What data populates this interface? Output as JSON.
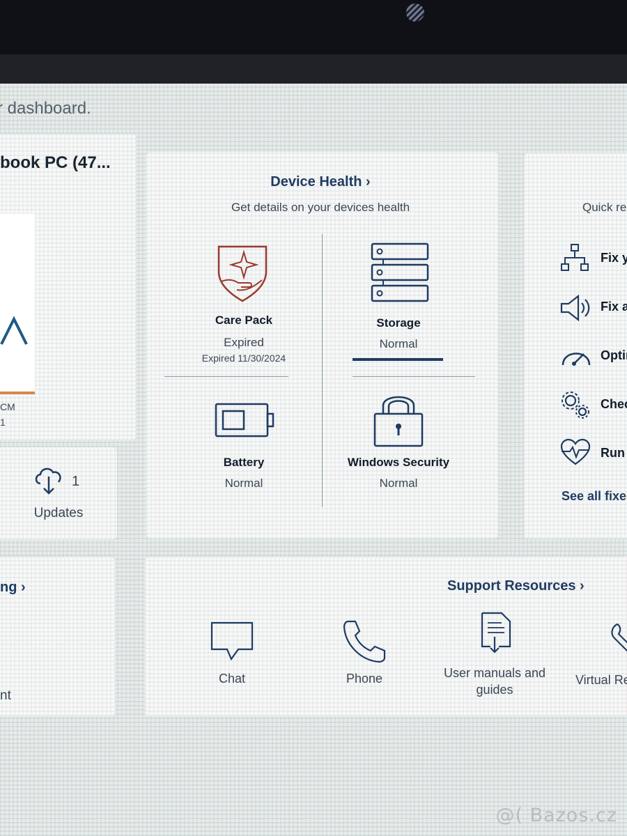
{
  "header": {
    "dashboard_text": "r dashboard.",
    "device_name": "book PC (47..."
  },
  "left_panel": {
    "model_fragment_1": "CM",
    "model_fragment_2": "1",
    "updates_count": "1",
    "updates_label": "Updates"
  },
  "device_health": {
    "title": "Device Health ›",
    "subtitle": "Get details on your devices health",
    "items": [
      {
        "label": "Care Pack",
        "status": "Expired",
        "detail": "Expired 11/30/2024",
        "icon": "shield-hand-icon"
      },
      {
        "label": "Storage",
        "status": "Normal",
        "icon": "storage-drives-icon"
      },
      {
        "label": "Battery",
        "status": "Normal",
        "icon": "battery-icon"
      },
      {
        "label": "Windows Security",
        "status": "Normal",
        "icon": "padlock-icon"
      }
    ]
  },
  "quick_fixes": {
    "title_fragment": "Quick re",
    "items": [
      {
        "label": "Fix y",
        "icon": "network-icon"
      },
      {
        "label": "Fix a",
        "icon": "speaker-icon"
      },
      {
        "label": "Optin",
        "icon": "gauge-icon"
      },
      {
        "label": "Chec",
        "icon": "gears-icon"
      },
      {
        "label": "Run",
        "icon": "heart-pulse-icon"
      }
    ],
    "see_all": "See all fixes"
  },
  "bottom_left": {
    "title_fragment": "ng ›",
    "text_fragment": "nt"
  },
  "support_resources": {
    "title": "Support Resources ›",
    "items": [
      {
        "label": "Chat",
        "icon": "chat-bubble-icon"
      },
      {
        "label": "Phone",
        "icon": "phone-icon"
      },
      {
        "label_line1": "User manuals and",
        "label_line2": "guides",
        "icon": "document-icon"
      },
      {
        "label": "Virtual Re",
        "icon": "wrench-icon"
      }
    ]
  },
  "watermark": "@( Bazos.cz",
  "colors": {
    "accent_blue": "#1f3b62",
    "care_pack_red": "#9a3a2e",
    "orange_bar": "#d9864a"
  }
}
